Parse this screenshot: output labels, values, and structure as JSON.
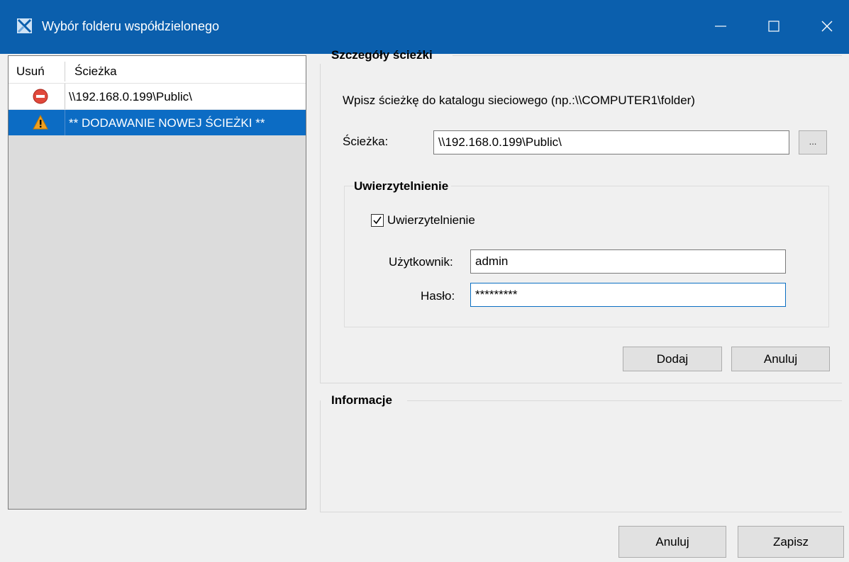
{
  "window": {
    "title": "Wybór folderu współdzielonego",
    "accent_color": "#0b5fad",
    "controls": [
      "minimize-icon",
      "maximize-icon",
      "close-icon"
    ]
  },
  "list": {
    "columns": [
      "Usuń",
      "Ścieżka"
    ],
    "rows": [
      {
        "icon": "delete-icon",
        "path": "\\\\192.168.0.199\\Public\\",
        "selected": false
      },
      {
        "icon": "warning-icon",
        "path": "** DODAWANIE NOWEJ ŚCIEŻKI **",
        "selected": true
      }
    ],
    "selected_color": "#0c6cc4"
  },
  "details": {
    "group_title": "Szczegóły ścieżki",
    "hint": "Wpisz ścieżkę do katalogu sieciowego (np.:\\\\COMPUTER1\\folder)",
    "path_label": "Ścieżka:",
    "path_value": "\\\\192.168.0.199\\Public\\",
    "browse_label": "...",
    "auth": {
      "group_title": "Uwierzytelnienie",
      "checkbox_label": "Uwierzytelnienie",
      "checked": true,
      "user_label": "Użytkownik:",
      "user_value": "admin",
      "password_label": "Hasło:",
      "password_value": "*********"
    },
    "add_button": "Dodaj",
    "cancel_button": "Anuluj"
  },
  "info": {
    "group_title": "Informacje"
  },
  "footer": {
    "cancel_button": "Anuluj",
    "save_button": "Zapisz"
  }
}
